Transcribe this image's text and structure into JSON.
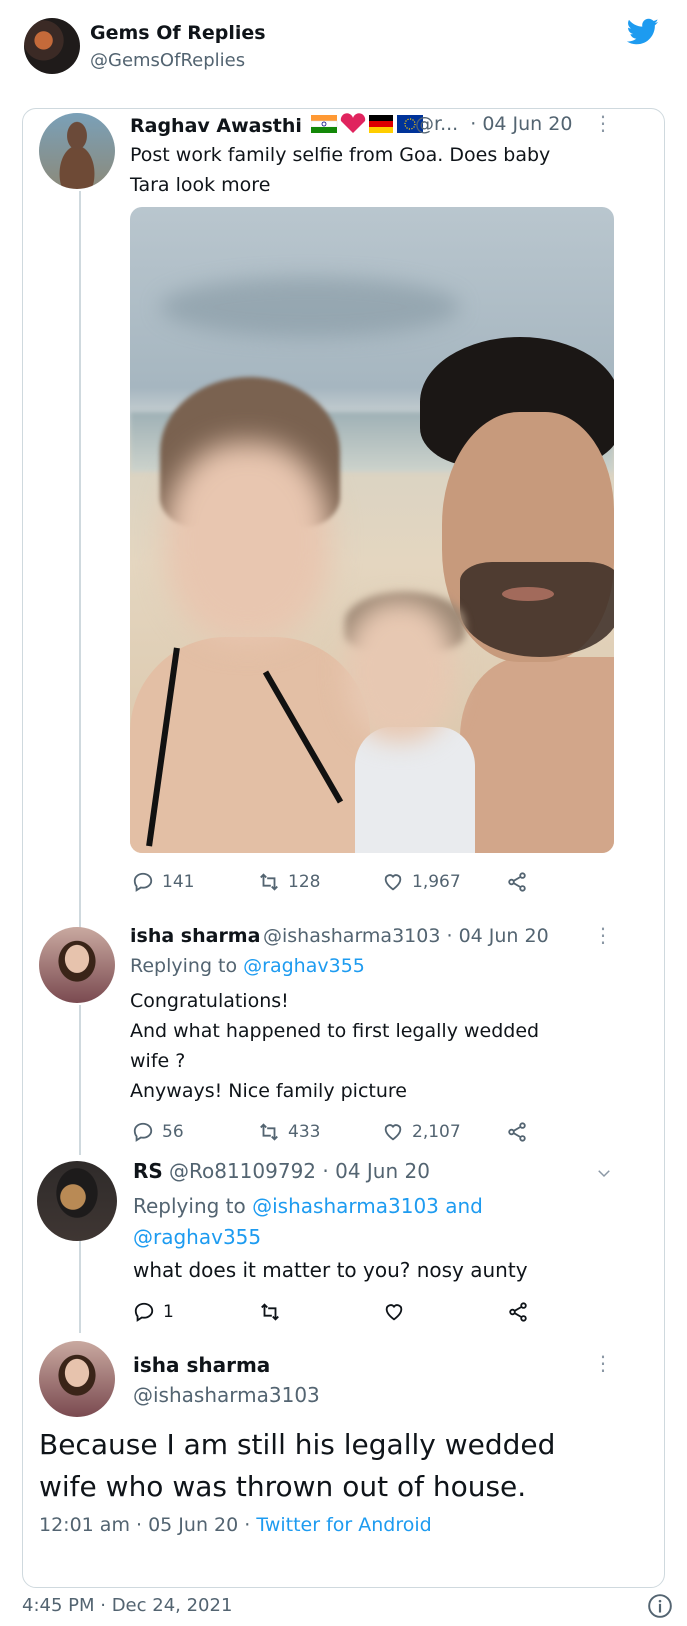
{
  "outer": {
    "name": "Gems Of Replies",
    "handle": "@GemsOfReplies",
    "footer_time": "4:45 PM · Dec 24, 2021"
  },
  "tweet1": {
    "name": "Raghav Awasthi",
    "handle": "@r...",
    "date": "· 04 Jun 20",
    "text_line1": "Post work family selfie from Goa. Does baby",
    "text_line2": "Tara look more",
    "replies": "141",
    "retweets": "128",
    "likes": "1,967"
  },
  "tweet2": {
    "name": "isha sharma",
    "handle": "@ishasharma3103",
    "date": "· 04 Jun 20",
    "replying_prefix": "Replying to ",
    "replying_to": "@raghav355",
    "line1": "Congratulations!",
    "line2": "And what happened to first legally wedded",
    "line3": "wife ?",
    "line4": "Anyways! Nice family picture",
    "replies": "56",
    "retweets": "433",
    "likes": "2,107"
  },
  "tweet3": {
    "name": "RS",
    "handle": "@Ro81109792",
    "date": "· 04 Jun 20",
    "replying_prefix": "Replying to ",
    "replying_to_1": "@ishasharma3103 and",
    "replying_to_2": "@raghav355",
    "text": "what does it matter to you? nosy aunty",
    "replies": "1"
  },
  "tweet4": {
    "name": "isha sharma",
    "handle": "@ishasharma3103",
    "line1": "Because I am still his legally wedded",
    "line2": "wife who was thrown out of house.",
    "time": "12:01 am",
    "date": "05 Jun 20",
    "source": "Twitter for Android"
  },
  "colors": {
    "link": "#1d9bf0",
    "muted": "#536471",
    "twitter_blue": "#1d9bf0"
  }
}
